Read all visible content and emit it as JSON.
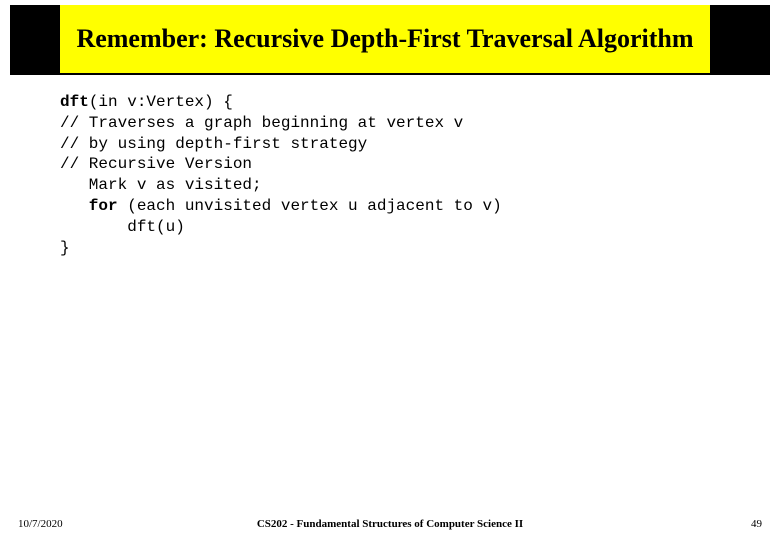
{
  "title": "Remember: Recursive Depth-First Traversal Algorithm",
  "code": {
    "kw_dft": "dft",
    "sig_rest": "(in v:Vertex) {",
    "c1": "// Traverses a graph beginning at vertex v",
    "c2": "// by using depth-first strategy",
    "c3": "// Recursive Version",
    "mark": "   Mark v as visited;",
    "kw_for": "   for",
    "for_rest": " (each unvisited vertex u adjacent to v)",
    "call": "       dft(u)",
    "close": "}"
  },
  "footer": {
    "date": "10/7/2020",
    "course": "CS202 - Fundamental Structures of Computer Science II",
    "page": "49"
  }
}
